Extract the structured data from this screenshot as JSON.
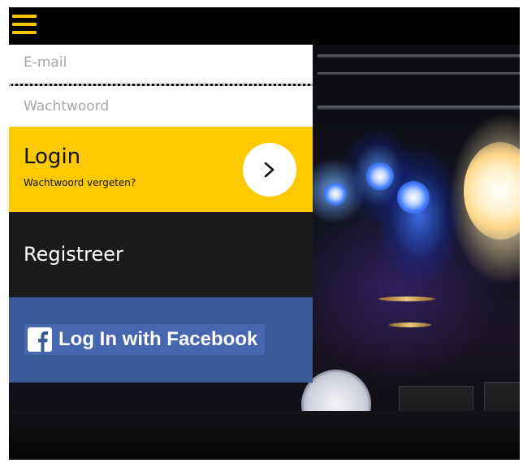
{
  "header": {
    "menu_icon": "hamburger-menu-icon"
  },
  "login_form": {
    "email_placeholder": "E-mail",
    "password_placeholder": "Wachtwoord",
    "login_label": "Login",
    "forgot_password_label": "Wachtwoord vergeten?",
    "submit_icon": "chevron-right-icon"
  },
  "register": {
    "label": "Registreer"
  },
  "facebook": {
    "label": "Log In with Facebook",
    "icon": "facebook-icon"
  },
  "colors": {
    "accent_yellow": "#fdc900",
    "dark_panel": "#1b1b1c",
    "facebook_blue": "#3b5998",
    "menu_icon": "#f7c600"
  }
}
